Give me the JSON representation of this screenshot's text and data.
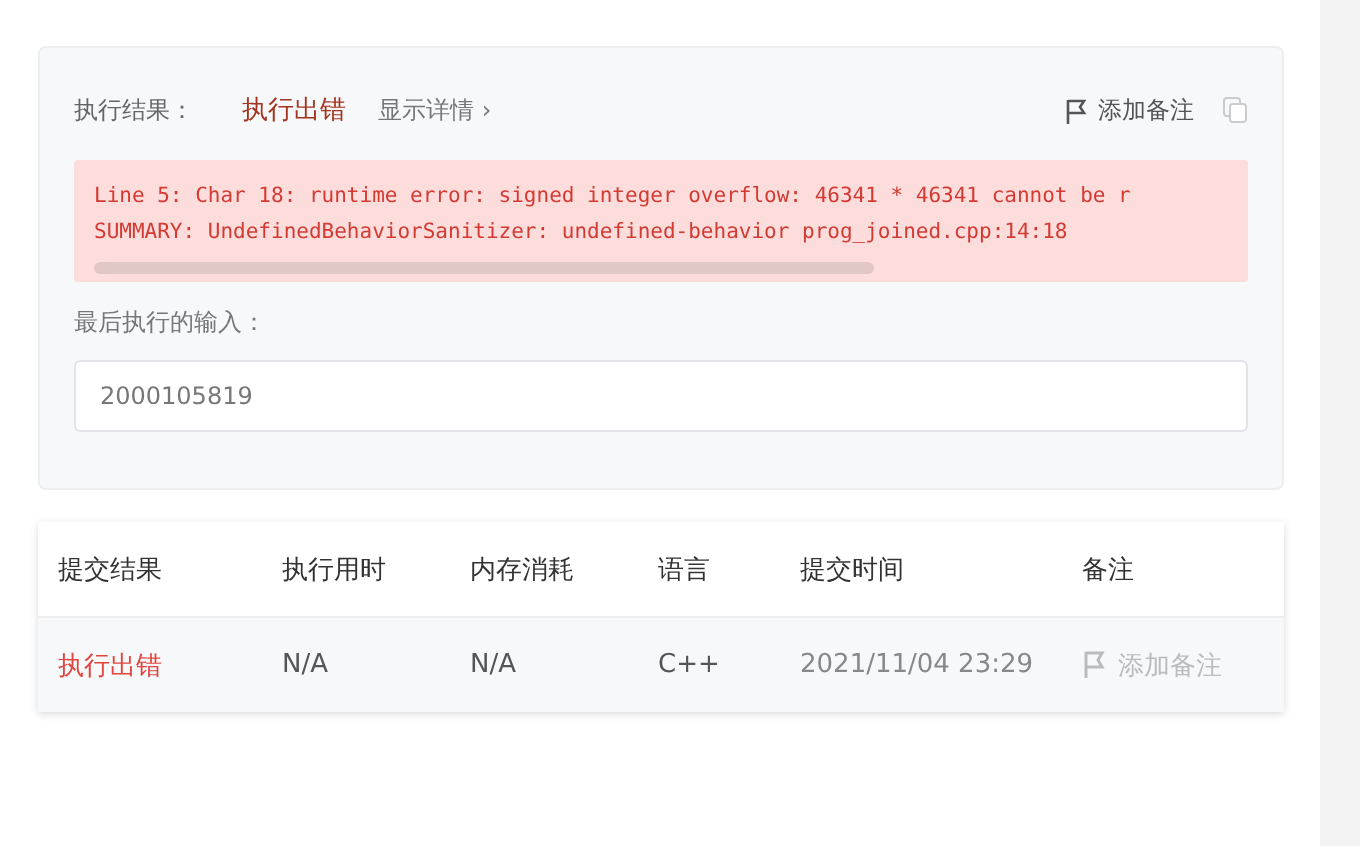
{
  "result": {
    "label": "执行结果：",
    "status": "执行出错",
    "details_link": "显示详情 ›",
    "note_button": "添加备注",
    "error_lines": [
      "Line 5: Char 18: runtime error: signed integer overflow: 46341 * 46341 cannot be r",
      "SUMMARY: UndefinedBehaviorSanitizer: undefined-behavior prog_joined.cpp:14:18"
    ],
    "last_input_label": "最后执行的输入：",
    "last_input": "2000105819"
  },
  "table": {
    "columns": [
      "提交结果",
      "执行用时",
      "内存消耗",
      "语言",
      "提交时间",
      "备注"
    ],
    "rows": [
      {
        "status": "执行出错",
        "color": "#e0463f",
        "runtime": "N/A",
        "memory": "N/A",
        "language": "C++",
        "time": "2021/11/04 23:29",
        "note": "添加备注",
        "note_disabled": true
      }
    ]
  }
}
